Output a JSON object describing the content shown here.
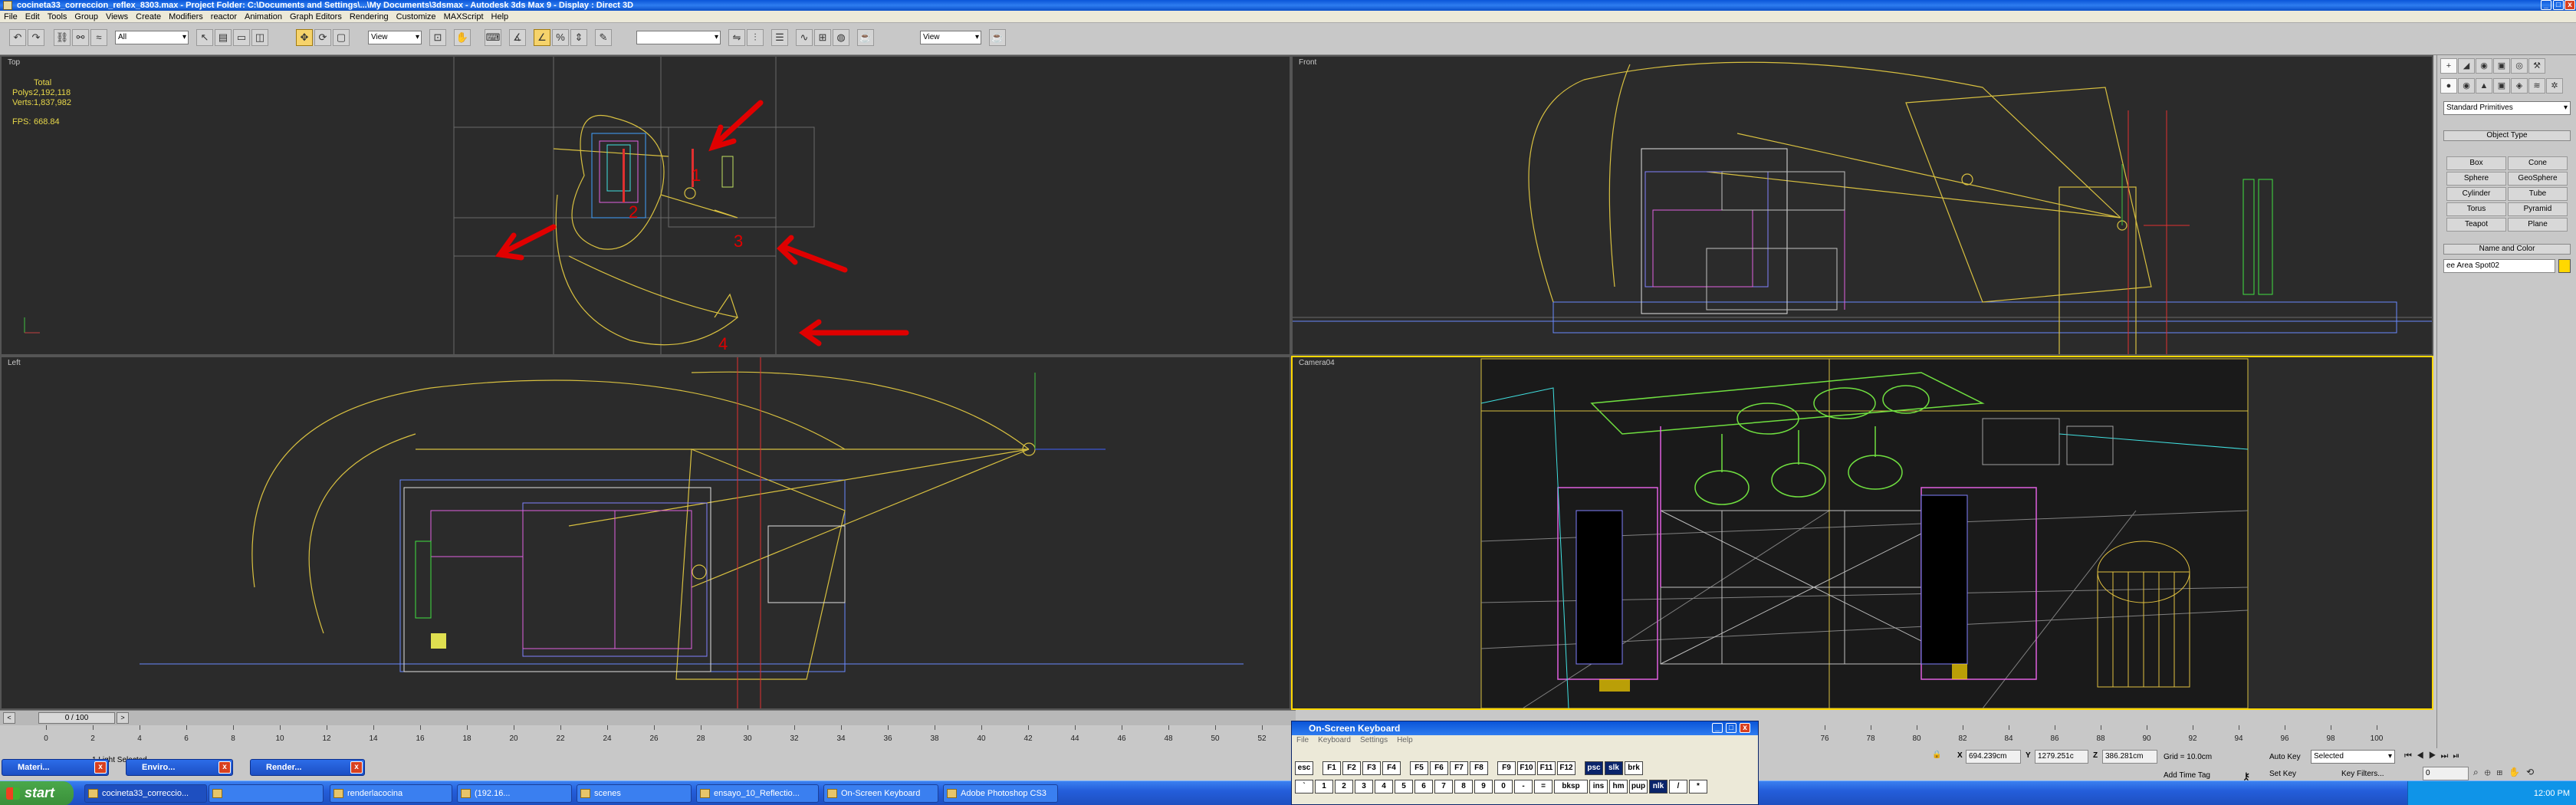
{
  "window": {
    "title": "cocineta33_correccion_reflex_8303.max - Project Folder: C:\\Documents and Settings\\...\\My Documents\\3dsmax - Autodesk 3ds Max 9 - Display : Direct 3D",
    "min": "_",
    "max": "□",
    "close": "x"
  },
  "menu": [
    "File",
    "Edit",
    "Tools",
    "Group",
    "Views",
    "Create",
    "Modifiers",
    "reactor",
    "Animation",
    "Graph Editors",
    "Rendering",
    "Customize",
    "MAXScript",
    "Help"
  ],
  "toolbar": {
    "filter": "All",
    "refcoord": "View",
    "refcoord2": "View",
    "snap_value": "",
    "selset": ""
  },
  "viewports": {
    "top": {
      "label": "Top"
    },
    "front": {
      "label": "Front"
    },
    "left": {
      "label": "Left"
    },
    "camera": {
      "label": "Camera04"
    }
  },
  "stats": {
    "total_label": "Total",
    "polys_label": "Polys:",
    "polys": "2,192,118",
    "verts_label": "Verts:",
    "verts": "1,837,982",
    "fps_label": "FPS:",
    "fps": "668.84"
  },
  "annotations": {
    "n1": "1",
    "n2": "2",
    "n3": "3",
    "n4": "4"
  },
  "command_panel": {
    "tabs": [
      "+",
      "◢",
      "◉",
      "▣",
      "◎",
      "⚒"
    ],
    "subtabs": [
      "●",
      "◉",
      "▲",
      "▣",
      "◈",
      "≋",
      "✲"
    ],
    "category": "Standard Primitives",
    "object_type_header": "Object Type",
    "autogrid": "",
    "buttons": [
      "Box",
      "Cone",
      "Sphere",
      "GeoSphere",
      "Cylinder",
      "Tube",
      "Torus",
      "Pyramid",
      "Teapot",
      "Plane"
    ],
    "name_color_header": "Name and Color",
    "object_name": "ee Area Spot02",
    "color": "#ffd800"
  },
  "time": {
    "slider": "0 / 100",
    "ticks": [
      "0",
      "2",
      "4",
      "6",
      "8",
      "10",
      "12",
      "14",
      "16",
      "18",
      "20",
      "22",
      "24",
      "26",
      "28",
      "30",
      "32",
      "34",
      "36",
      "38",
      "40",
      "42",
      "44",
      "46",
      "48",
      "50",
      "52"
    ],
    "right_ticks": [
      "76",
      "78",
      "80",
      "82",
      "84",
      "86",
      "88",
      "90",
      "92",
      "94",
      "96",
      "98",
      "100"
    ]
  },
  "status": {
    "selected": "1 Light Selected",
    "x_label": "X",
    "x": "694.239cm",
    "y_label": "Y",
    "y": "1279.251c",
    "z_label": "Z",
    "z": "386.281cm",
    "grid": "Grid = 10.0cm",
    "add_time_tag": "Add Time Tag",
    "auto_key": "Auto Key",
    "auto_key_sel": "Selected",
    "set_key": "Set Key",
    "key_filters": "Key Filters...",
    "frame": "0"
  },
  "mini_windows": [
    "Materi...",
    "Enviro...",
    "Render..."
  ],
  "osk": {
    "title": "On-Screen Keyboard",
    "menu": [
      "File",
      "Keyboard",
      "Settings",
      "Help"
    ],
    "row1": [
      "esc",
      "F1",
      "F2",
      "F3",
      "F4",
      "F5",
      "F6",
      "F7",
      "F8",
      "F9",
      "F10",
      "F11",
      "F12",
      "psc",
      "slk",
      "brk"
    ],
    "row2": [
      "`",
      "1",
      "2",
      "3",
      "4",
      "5",
      "6",
      "7",
      "8",
      "9",
      "0",
      "-",
      "=",
      "bksp",
      "ins",
      "hm",
      "pup",
      "nlk",
      "/",
      "*"
    ]
  },
  "taskbar": {
    "start": "start",
    "tasks": [
      "cocineta33_correccio...",
      "",
      "renderlacocina",
      "(192.16...",
      "scenes",
      "ensayo_10_Reflectio...",
      "On-Screen Keyboard",
      "Adobe Photoshop CS3"
    ],
    "clock": "12:00 PM"
  }
}
